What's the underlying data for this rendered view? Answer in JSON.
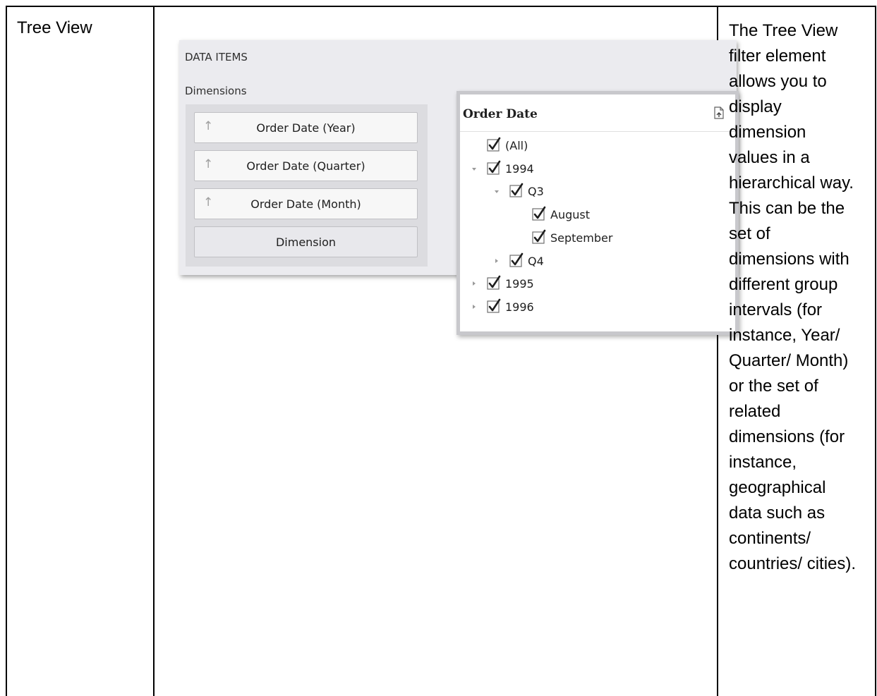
{
  "table": {
    "name": "Tree View",
    "description": "The Tree View filter element allows you to display dimension values in a hierarchical way. This can be the set of dimensions with different group intervals (for instance, Year/ Quarter/ Month) or the set of related dimensions (for instance, geographical data such as continents/ countries/ cities)."
  },
  "data_items": {
    "heading": "DATA ITEMS",
    "group_label": "Dimensions",
    "buttons": [
      "Order Date (Year)",
      "Order Date (Quarter)",
      "Order Date (Month)"
    ],
    "placeholder": "Dimension"
  },
  "tree": {
    "title": "Order Date",
    "nodes": [
      {
        "label": "(All)",
        "checked": true,
        "expander": "none"
      },
      {
        "label": "1994",
        "checked": true,
        "expander": "expanded"
      },
      {
        "label": "Q3",
        "checked": true,
        "expander": "expanded"
      },
      {
        "label": "August",
        "checked": true,
        "expander": "none"
      },
      {
        "label": "September",
        "checked": true,
        "expander": "none"
      },
      {
        "label": "Q4",
        "checked": true,
        "expander": "collapsed"
      },
      {
        "label": "1995",
        "checked": true,
        "expander": "collapsed"
      },
      {
        "label": "1996",
        "checked": true,
        "expander": "collapsed"
      }
    ],
    "icons": {
      "export": "export-document-icon",
      "check": "checkbox-checked-icon"
    }
  }
}
